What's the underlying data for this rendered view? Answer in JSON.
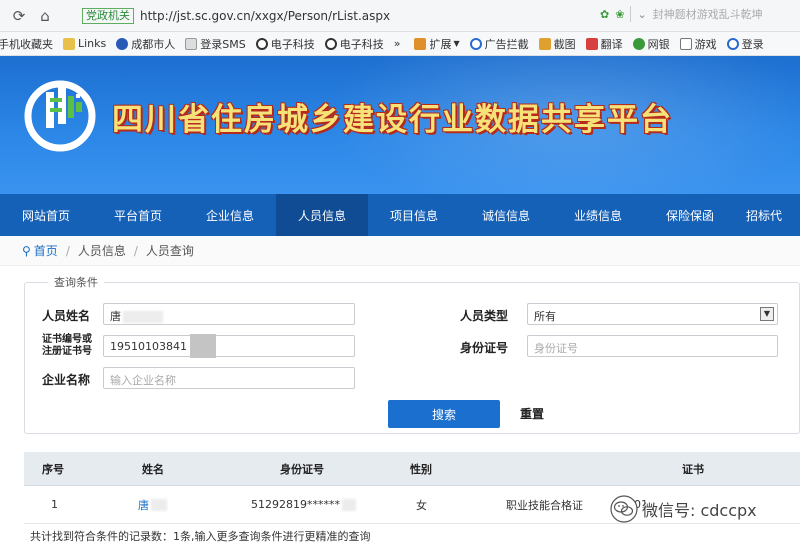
{
  "browser": {
    "cert_label": "党政机关",
    "url_host": "http://jst.sc.gov.cn",
    "url_path": "/xxgx/Person/rList.aspx",
    "ad_text": "封神题材游戏乱斗乾坤"
  },
  "bookmarks": [
    "手机收藏夹",
    "Links",
    "成都市人",
    "登录SMS",
    "电子科技",
    "电子科技",
    "»",
    "扩展",
    "广告拦截",
    "截图",
    "翻译",
    "网银",
    "游戏",
    "登录"
  ],
  "site": {
    "title": "四川省住房城乡建设行业数据共享平台"
  },
  "nav": {
    "items": [
      "网站首页",
      "平台首页",
      "企业信息",
      "人员信息",
      "项目信息",
      "诚信信息",
      "业绩信息",
      "保险保函",
      "招标代"
    ],
    "active_index": 3
  },
  "breadcrumb": {
    "home": "首页",
    "level1": "人员信息",
    "level2": "人员查询"
  },
  "query": {
    "legend": "查询条件",
    "name_label": "人员姓名",
    "name_value": "唐",
    "cert_label_line1": "证书编号或",
    "cert_label_line2": "注册证书号",
    "cert_value": "19510103841",
    "company_label": "企业名称",
    "company_placeholder": "输入企业名称",
    "type_label": "人员类型",
    "type_value": "所有",
    "id_label": "身份证号",
    "id_placeholder": "身份证号",
    "search_label": "搜索",
    "reset_label": "重置"
  },
  "table": {
    "headers": [
      "序号",
      "姓名",
      "身份证号",
      "性别",
      "证书"
    ],
    "rows": [
      {
        "index": "1",
        "name": "唐",
        "id_no": "51292819******",
        "gender": "女",
        "cert": "职业技能合格证",
        "cert_no": "5101"
      }
    ]
  },
  "footer": {
    "summary": "共计找到符合条件的记录数：1条,输入更多查询条件进行更精准的查询"
  },
  "watermark": {
    "text": "微信号: cdccpx"
  }
}
